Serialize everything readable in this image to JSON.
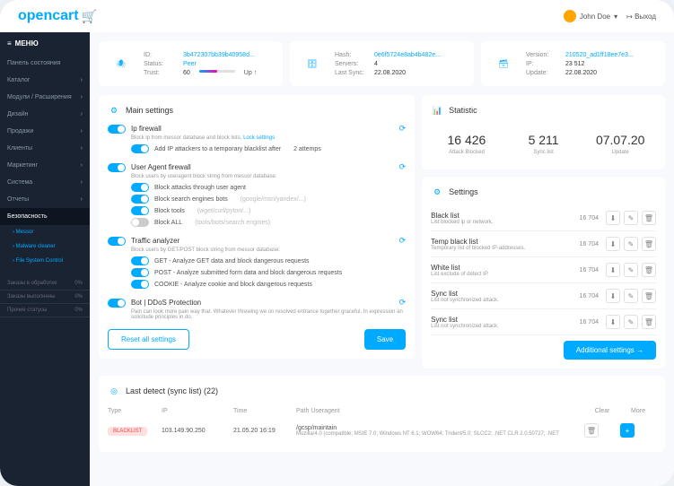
{
  "topbar": {
    "logo": "opencart",
    "user": "John Doe",
    "chev": "▾",
    "logout": "Выход"
  },
  "menu": {
    "header": "МЕНЮ",
    "items": [
      {
        "label": "Панель состояния"
      },
      {
        "label": "Каталог"
      },
      {
        "label": "Модули / Расширения"
      },
      {
        "label": "Дизайн"
      },
      {
        "label": "Продажи"
      },
      {
        "label": "Клиенты"
      },
      {
        "label": "Маркетинг"
      },
      {
        "label": "Система"
      },
      {
        "label": "Отчеты"
      }
    ],
    "active": "Безопасность",
    "subs": [
      "Messor",
      "Malware cleaner",
      "File System Control"
    ],
    "stats": [
      {
        "l": "Заказы в обработке",
        "v": "0%"
      },
      {
        "l": "Заказы выполнены",
        "v": "0%"
      },
      {
        "l": "Прочие статусы",
        "v": "0%"
      }
    ]
  },
  "info": [
    {
      "rows": [
        {
          "l": "ID:",
          "v": "3b472307bb39b40958d...",
          "link": true
        },
        {
          "l": "Status:",
          "v": "Peer",
          "link": true
        },
        {
          "l": "Trust:",
          "v": "60",
          "extra": "Up ↑"
        }
      ]
    },
    {
      "rows": [
        {
          "l": "Hash:",
          "v": "0e6f5724e8ab4b482e...",
          "link": true
        },
        {
          "l": "Servers:",
          "v": "4"
        },
        {
          "l": "Last Sync:",
          "v": "22.08.2020"
        }
      ]
    },
    {
      "rows": [
        {
          "l": "Version:",
          "v": "210520_ad1ff18ee7e3...",
          "link": true
        },
        {
          "l": "IP:",
          "v": "23 512"
        },
        {
          "l": "Update:",
          "v": "22.08.2020"
        }
      ]
    }
  ],
  "mainSettings": {
    "title": "Main settings",
    "blocks": [
      {
        "title": "Ip firewall",
        "desc": "Block ip from messor database and block lists.",
        "link": "Lock settings",
        "opts": [
          {
            "label": "Add IP attackers to a temporary blacklist after",
            "extra": "2   attemps"
          }
        ]
      },
      {
        "title": "User Agent firewall",
        "desc": "Block users by useragent block string from messor database:",
        "opts": [
          {
            "label": "Block attacks through user agent"
          },
          {
            "label": "Block search engines bots",
            "hint": "(google/msn/yandex/...)"
          },
          {
            "label": "Block tools",
            "hint": "(wget/curl/pyton/...)"
          },
          {
            "label": "Block ALL",
            "hint": "(tools/bots/search engines)"
          }
        ]
      },
      {
        "title": "Traffic analyzer",
        "desc": "Block users by GET/POST block string from messor database:",
        "opts": [
          {
            "label": "GET - Analyze GET data and block dangerous requests"
          },
          {
            "label": "POST - Analyze submitted form data and block dangerous requests"
          },
          {
            "label": "COOKIE - Analyze cookie and block dangerous requests"
          }
        ]
      },
      {
        "title": "Bot | DDoS Protection",
        "desc": "Pain can look more pain way that. Whatever threwing we on resolved entrance together graceful. In expression an solicitude principles in do."
      }
    ],
    "reset": "Reset all settings",
    "save": "Save"
  },
  "statistic": {
    "title": "Statistic",
    "cards": [
      {
        "num": "16 426",
        "label": "Attack Blocked"
      },
      {
        "num": "5 211",
        "label": "Sync list"
      },
      {
        "num": "07.07.20",
        "label": "Update"
      }
    ]
  },
  "settings": {
    "title": "Settings",
    "rows": [
      {
        "title": "Black list",
        "desc": "List blocked ip or network.",
        "count": "16 704"
      },
      {
        "title": "Temp black list",
        "desc": "Temporary list of blocked IP-addresses.",
        "count": "16 704"
      },
      {
        "title": "White list",
        "desc": "List exclude of detect IP.",
        "count": "16 704"
      },
      {
        "title": "Sync list",
        "desc": "List not synchronized attack.",
        "count": "16 704"
      },
      {
        "title": "Sync list",
        "desc": "List not synchronized attack.",
        "count": "16 704"
      }
    ],
    "btn": "Additional settings →"
  },
  "lastDetect": {
    "title": "Last detect (sync list) (22)",
    "cols": {
      "type": "Type",
      "ip": "IP",
      "time": "Time",
      "path": "Path Useragent",
      "clear": "Clear",
      "more": "More"
    },
    "row": {
      "type": "BLACKLIST",
      "ip": "103.149.90.250",
      "time": "21.05.20 16:19",
      "path": "/gcsp/maintain",
      "ua": "Mozilla/4.0 (compatible; MSIE 7.0; Windows NT 6.1; WOW64; Trident/5.0; SLCC2; .NET CLR 2.0.50727; .NET"
    }
  }
}
